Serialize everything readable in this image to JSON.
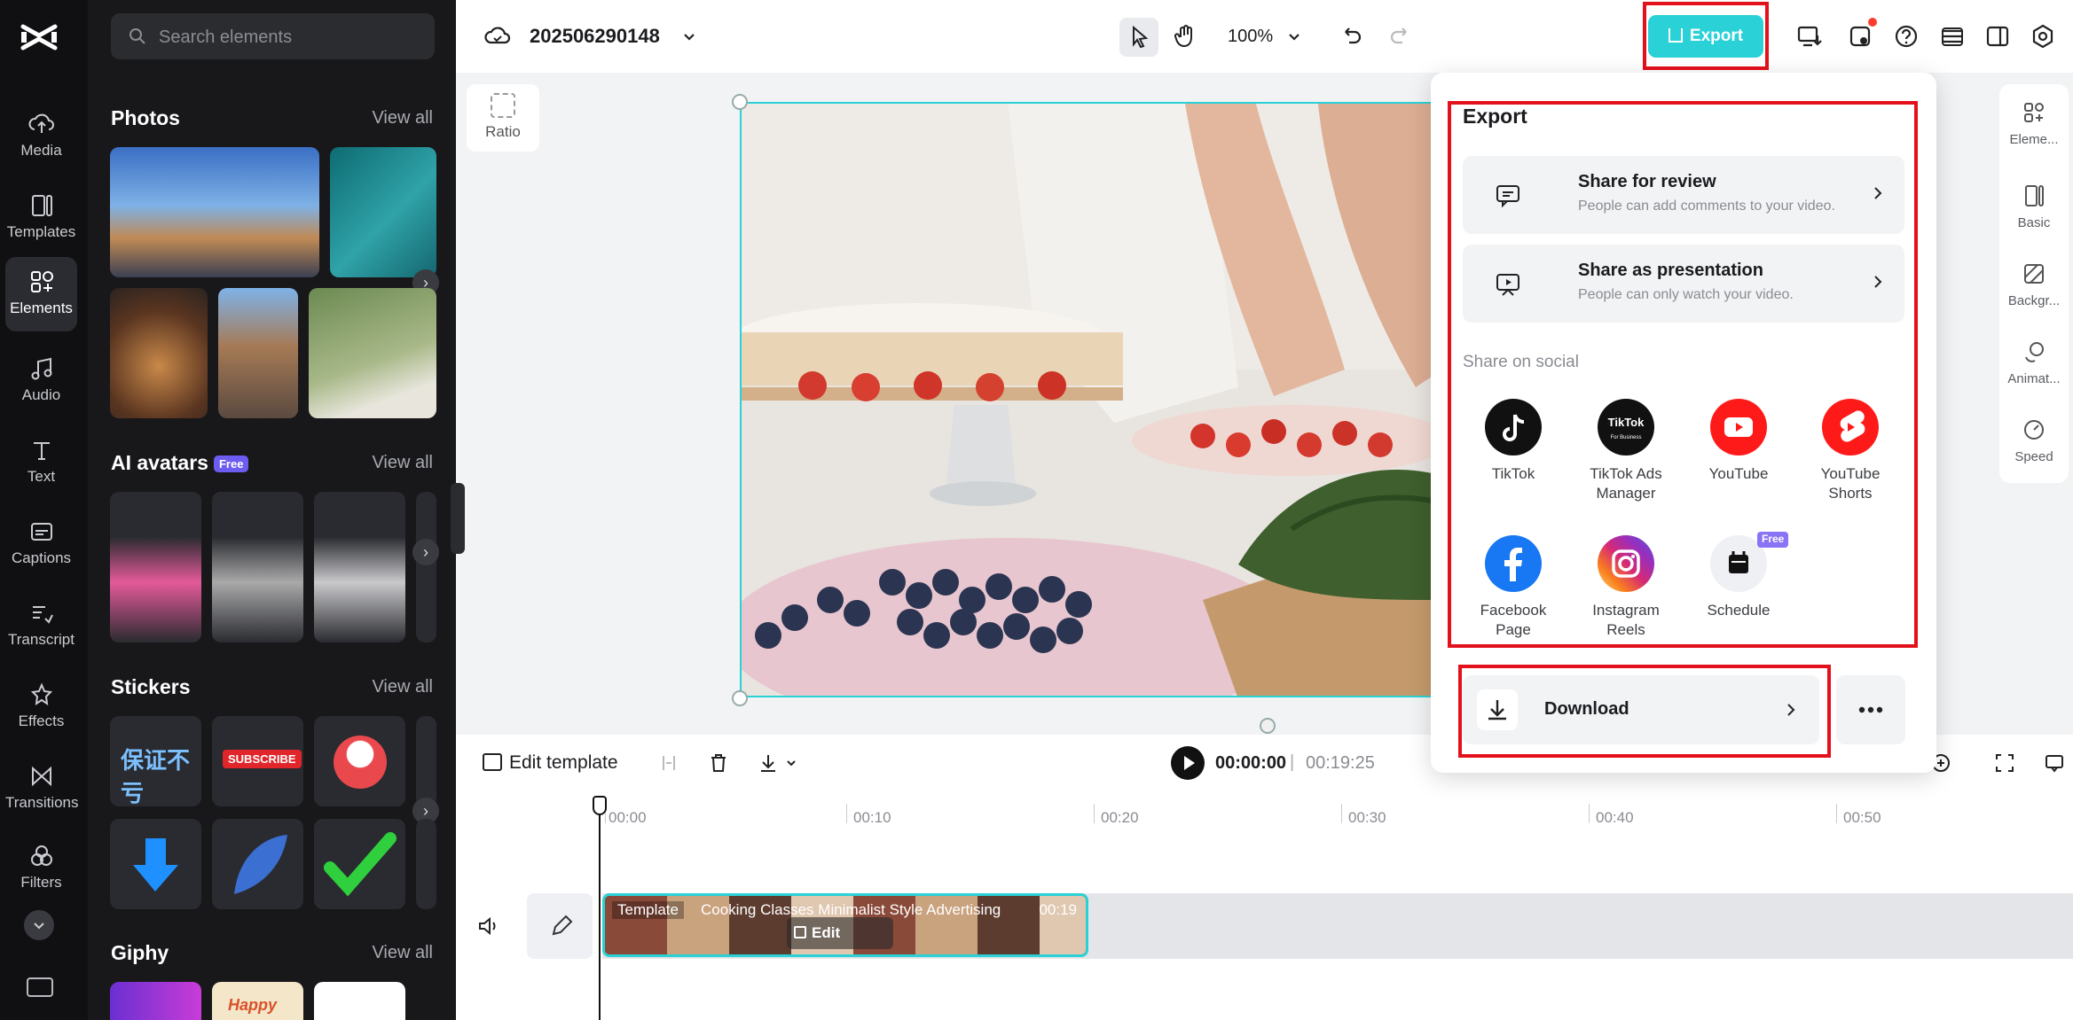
{
  "rail": {
    "items": [
      {
        "label": "Media",
        "icon": "cloud-upload-icon"
      },
      {
        "label": "Templates",
        "icon": "templates-icon"
      },
      {
        "label": "Elements",
        "icon": "elements-icon",
        "active": true
      },
      {
        "label": "Audio",
        "icon": "music-note-icon"
      },
      {
        "label": "Text",
        "icon": "text-icon"
      },
      {
        "label": "Captions",
        "icon": "captions-icon"
      },
      {
        "label": "Transcript",
        "icon": "transcript-icon"
      },
      {
        "label": "Effects",
        "icon": "effects-icon"
      },
      {
        "label": "Transitions",
        "icon": "transitions-icon"
      },
      {
        "label": "Filters",
        "icon": "filters-icon"
      }
    ]
  },
  "panel": {
    "search_placeholder": "Search elements",
    "sections": {
      "photos": "Photos",
      "ai_avatars": "AI avatars",
      "ai_avatars_badge": "Free",
      "stickers": "Stickers",
      "giphy": "Giphy"
    },
    "view_all": "View all",
    "sticker_texts": {
      "subscribe": "SUBSCRIBE",
      "chinese": "保证不亏",
      "happy": "Happy"
    }
  },
  "topbar": {
    "project_name": "202506290148",
    "zoom": "100%",
    "export_label": "Export"
  },
  "canvas": {
    "ratio_label": "Ratio"
  },
  "right_rail": {
    "items": [
      {
        "label": "Eleme...",
        "icon": "elements-settings-icon"
      },
      {
        "label": "Basic",
        "icon": "basic-icon"
      },
      {
        "label": "Backgr...",
        "icon": "background-icon"
      },
      {
        "label": "Animat...",
        "icon": "animation-icon"
      },
      {
        "label": "Speed",
        "icon": "speed-icon"
      }
    ]
  },
  "timeline": {
    "edit_template": "Edit template",
    "current_time": "00:00:00",
    "separator": "|",
    "total_time": "00:19:25",
    "ruler": [
      "00:00",
      "00:10",
      "00:20",
      "00:30",
      "00:40",
      "00:50"
    ],
    "clip": {
      "tag": "Template",
      "title": "Cooking Classes Minimalist Style Advertising",
      "duration": "00:19",
      "edit_label": "Edit template"
    }
  },
  "export_popup": {
    "title": "Export",
    "share_review": {
      "title": "Share for review",
      "desc": "People can add comments to your video."
    },
    "share_presentation": {
      "title": "Share as presentation",
      "desc": "People can only watch your video."
    },
    "social_label": "Share on social",
    "socials": [
      {
        "name": "TikTok",
        "icon": "tiktok-icon",
        "color": "#111111"
      },
      {
        "name": "TikTok Ads Manager",
        "icon": "tiktok-ads-icon",
        "color": "#111111",
        "logo_text": "TikTok",
        "logo_sub": "For Business"
      },
      {
        "name": "YouTube",
        "icon": "youtube-icon",
        "color": "#ff1a1a"
      },
      {
        "name": "YouTube Shorts",
        "icon": "youtube-shorts-icon",
        "color": "#ff1a1a"
      },
      {
        "name": "Facebook Page",
        "icon": "facebook-icon",
        "color": "#1877f2"
      },
      {
        "name": "Instagram Reels",
        "icon": "instagram-icon",
        "color": "#d62976"
      },
      {
        "name": "Schedule",
        "icon": "calendar-icon",
        "color": "#eef0f3",
        "badge": "Free"
      }
    ],
    "download_label": "Download"
  },
  "colors": {
    "accent": "#2ad1d6",
    "highlight": "#e3111b",
    "dark_bg": "#18181b"
  }
}
